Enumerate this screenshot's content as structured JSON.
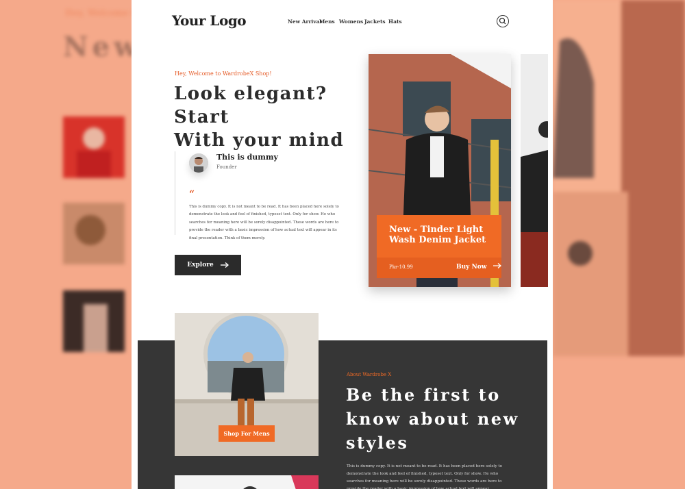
{
  "backdrop": {
    "left_tagline": "Hey, Welcome to WardrobeX Shop!",
    "left_heading": "New A"
  },
  "header": {
    "logo": "Your Logo",
    "nav": [
      "New Arrival",
      "Mens",
      "Womens",
      "Jackets",
      "Hats"
    ],
    "search_icon": "search-icon"
  },
  "hero": {
    "tagline": "Hey, Welcome to WardrobeX Shop!",
    "headline_line1": "Look elegant? Start",
    "headline_line2": "With your mind",
    "testimonial": {
      "name": "This is dummy",
      "role": "Founder",
      "quote_mark": "“",
      "text": "This is dummy copy. It is not meant to be read. It has been placed here solely to demonstrate the look and feel of finished, typeset text. Only for show. He who searches for meaning here will be sorely disappointed. These words are here to provide the reader with a basic impression of how actual text will appear in its final presentation. Think of them merely."
    },
    "explore_label": "Explore",
    "arrow_icon": "arrow-right-icon"
  },
  "featured": {
    "title": "New - Tinder Light Wash Denim Jacket",
    "price": "Pkr-10.99",
    "buy_label": "Buy Now"
  },
  "about": {
    "shop_button": "Shop For Mens",
    "tag": "About Wardrobe X",
    "headline_line1": "Be the first to",
    "headline_line2": "know about new",
    "headline_line3": "styles",
    "body": "This is dummy copy. It is not meant to be read. It has been placed here solely to demonstrate the look and feel of finished, typeset text. Only for show. He who searches for meaning here will be sorely disappointed. These words are here to provide the reader with a basic impression of how actual text will appear."
  },
  "colors": {
    "accent": "#f06a25",
    "dark": "#363636",
    "backdrop": "#f2a888"
  }
}
